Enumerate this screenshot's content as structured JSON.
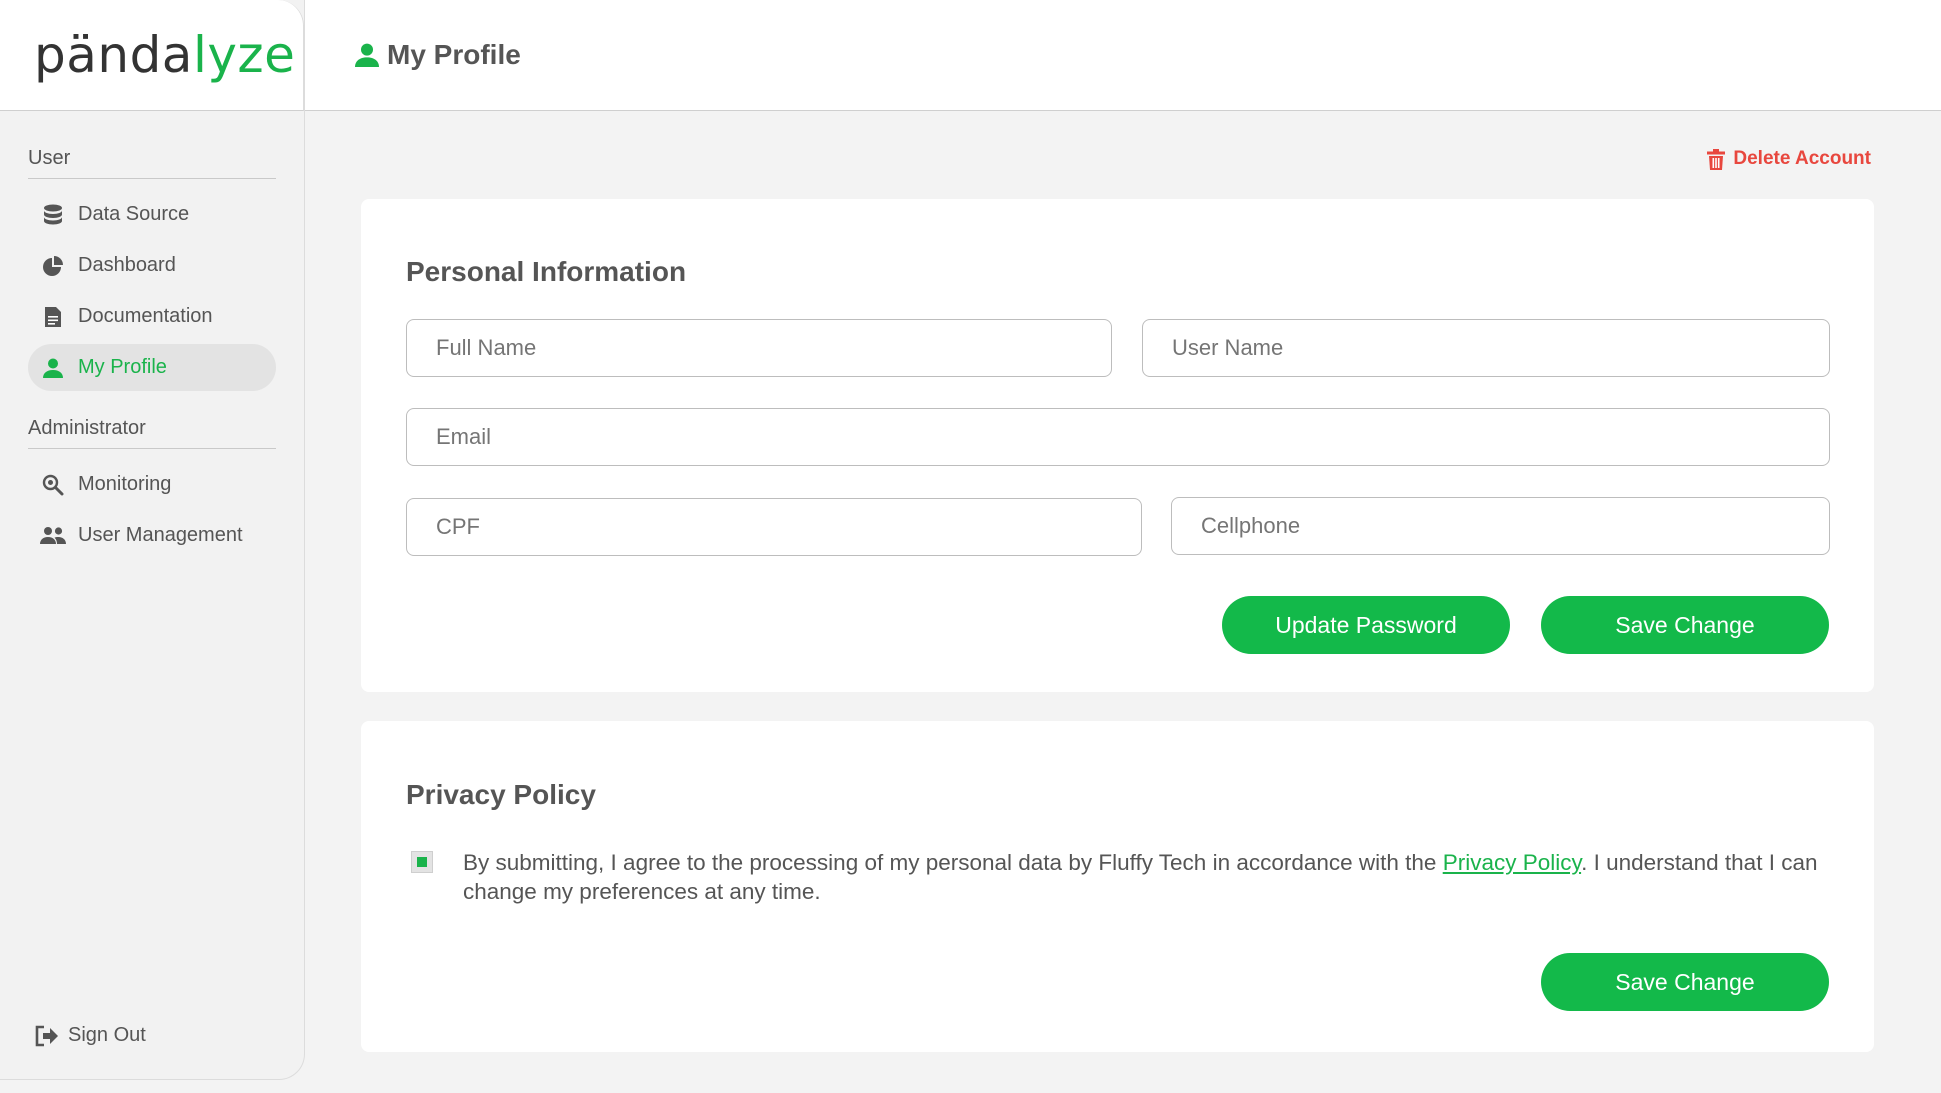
{
  "brand": {
    "logo_text_a": "pända",
    "logo_text_b": "lyze"
  },
  "sidebar": {
    "user_section": "User",
    "user_items": [
      {
        "label": "Data Source",
        "icon": "database-icon"
      },
      {
        "label": "Dashboard",
        "icon": "pie-chart-icon"
      },
      {
        "label": "Documentation",
        "icon": "document-icon"
      },
      {
        "label": "My Profile",
        "icon": "user-icon",
        "active": true
      }
    ],
    "admin_section": "Administrator",
    "admin_items": [
      {
        "label": "Monitoring",
        "icon": "magnifier-icon"
      },
      {
        "label": "User Management",
        "icon": "users-icon"
      }
    ],
    "signout": "Sign Out"
  },
  "header": {
    "title": "My Profile",
    "icon": "user-icon"
  },
  "delete_account": "Delete Account",
  "personal": {
    "title": "Personal Information",
    "full_name_placeholder": "Full Name",
    "user_name_placeholder": "User Name",
    "email_placeholder": "Email",
    "cpf_placeholder": "CPF",
    "cellphone_placeholder": "Cellphone",
    "update_password": "Update Password",
    "save": "Save Change"
  },
  "privacy": {
    "title": "Privacy Policy",
    "text_before": "By submitting, I agree to the processing of my personal data by Fluffy Tech in accordance with the ",
    "link": "Privacy Policy",
    "text_after": ". I understand that I can change my preferences at any time.",
    "save": "Save Change"
  },
  "colors": {
    "accent": "#1ab34b",
    "danger": "#e8473e"
  }
}
